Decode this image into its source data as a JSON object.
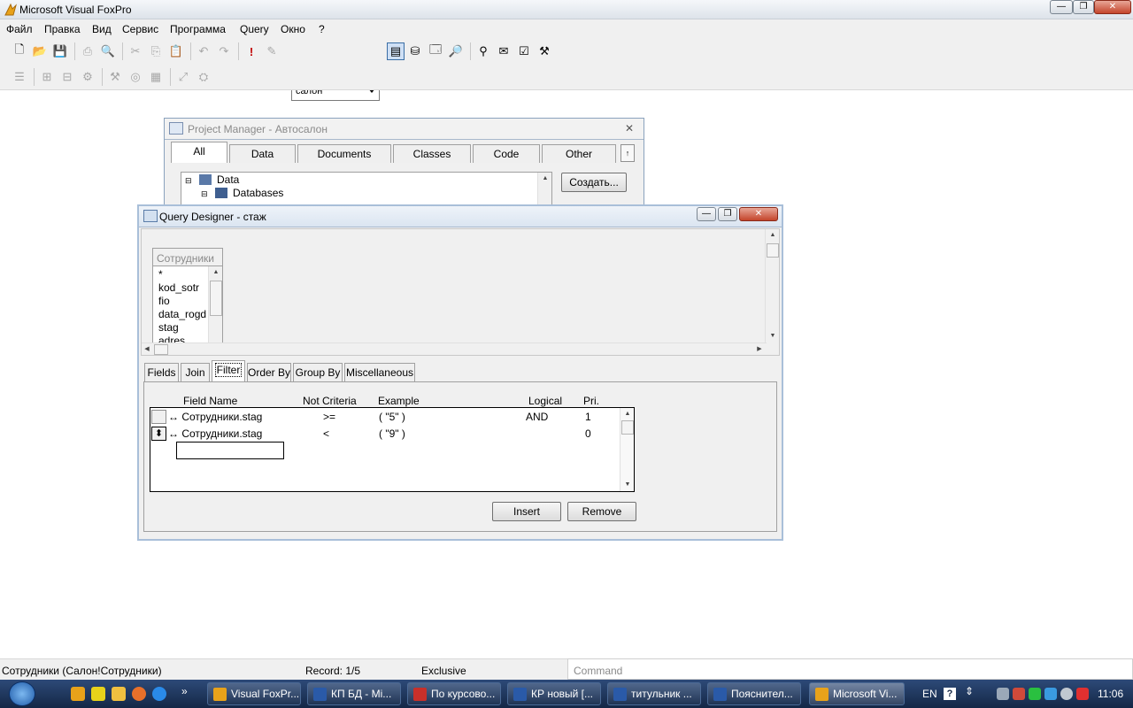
{
  "app": {
    "title": "Microsoft Visual FoxPro"
  },
  "caption_buttons": {
    "minimize": "—",
    "restore": "❐",
    "close": "✕"
  },
  "menu": [
    "Файл",
    "Правка",
    "Вид",
    "Сервис",
    "Программа",
    "Query",
    "Окно",
    "?"
  ],
  "toolbar": {
    "combo_value": "салон"
  },
  "project_manager": {
    "title": "Project Manager - Автосалон",
    "tabs": [
      "All",
      "Data",
      "Documents",
      "Classes",
      "Code",
      "Other"
    ],
    "tree": [
      "Data",
      "Databases"
    ],
    "create_button": "Создать..."
  },
  "query_designer": {
    "title": "Query Designer - стаж",
    "table": {
      "name": "Сотрудники",
      "fields": [
        "*",
        "kod_sotr",
        "fio",
        "data_rogd",
        "stag",
        "adres"
      ]
    },
    "tabs": [
      "Fields",
      "Join",
      "Filter",
      "Order By",
      "Group By",
      "Miscellaneous"
    ],
    "active_tab": "Filter",
    "columns": {
      "field_name": "Field Name",
      "not": "Not",
      "criteria": "Criteria",
      "example": "Example",
      "logical": "Logical",
      "pri": "Pri."
    },
    "rows": [
      {
        "mover": "",
        "field": "↔ Сотрудники.stag",
        "criteria": ">=",
        "example": "( \"5\" )",
        "logical": "AND",
        "pri": "1"
      },
      {
        "mover": "⬍",
        "field": "↔ Сотрудники.stag",
        "criteria": "<",
        "example": "( \"9\" )",
        "logical": "",
        "pri": "0"
      }
    ],
    "insert_button": "Insert",
    "remove_button": "Remove"
  },
  "status": {
    "table": "Сотрудники (Салон!Сотрудники)",
    "record": "Record: 1/5",
    "mode": "Exclusive",
    "command_placeholder": "Command"
  },
  "taskbar": {
    "tasks": [
      "Visual FoxPr...",
      "КП БД - Mi...",
      "По курсово...",
      "КР новый [...",
      "титульник ...",
      "Пояснител...",
      "Microsoft Vi..."
    ],
    "tray_lang": "EN",
    "clock": "11:06"
  }
}
